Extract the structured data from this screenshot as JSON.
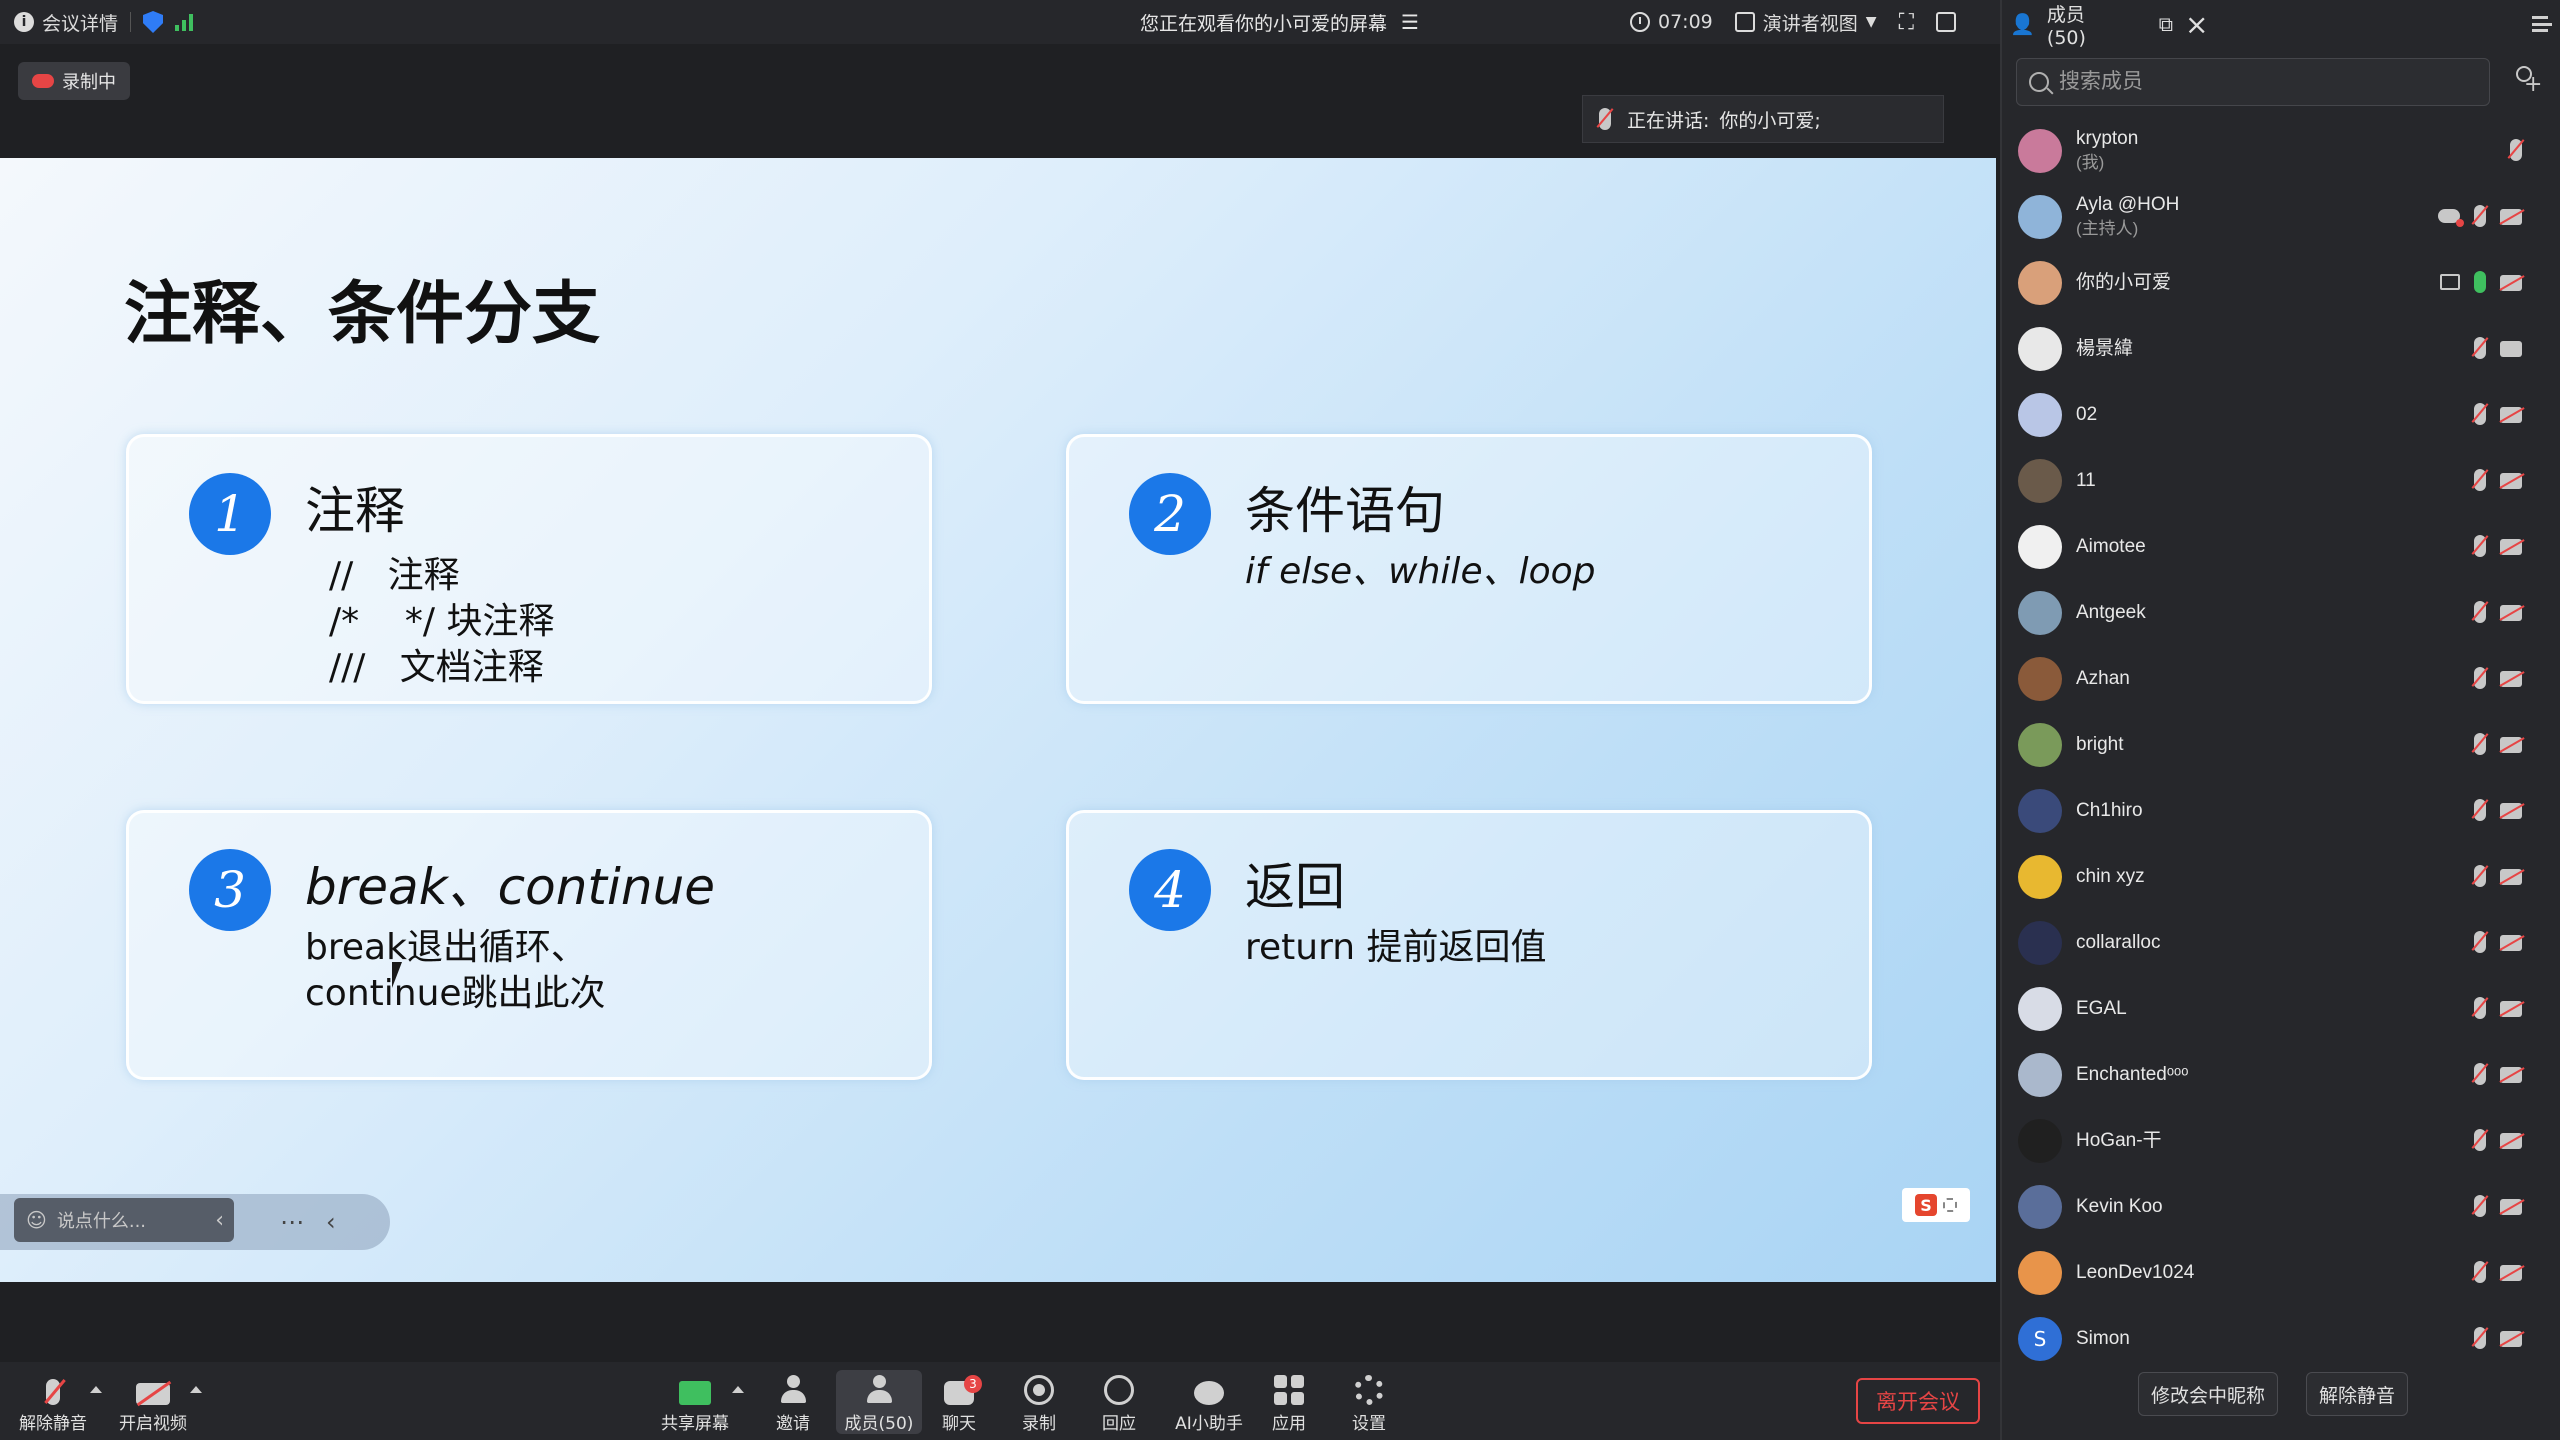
{
  "topbar": {
    "meeting_info": "会议详情",
    "watching": "您正在观看你的小可爱的屏幕",
    "time": "07:09",
    "view_mode": "演讲者视图",
    "members_tab": "成员(50)"
  },
  "recording": {
    "label": "录制中"
  },
  "speaking": {
    "label": "正在讲话:",
    "name": "你的小可爱;"
  },
  "slide": {
    "title": "注释、条件分支",
    "cards": [
      {
        "num": "1",
        "title": "注释",
        "lines": [
          "//   注释",
          "/*    */ 块注释",
          "///   文档注释"
        ]
      },
      {
        "num": "2",
        "title": "条件语句",
        "lines": [
          "if else、while、loop"
        ]
      },
      {
        "num": "3",
        "title": "break、continue",
        "lines": [
          "break退出循环、",
          "continue跳出此次"
        ]
      },
      {
        "num": "4",
        "title": "返回",
        "lines": [
          "return 提前返回值"
        ]
      }
    ],
    "chat_placeholder": "说点什么..."
  },
  "toolbar": {
    "unmute": "解除静音",
    "start_video": "开启视频",
    "share": "共享屏幕",
    "invite": "邀请",
    "members": "成员(50)",
    "chat": "聊天",
    "chat_badge": "3",
    "record": "录制",
    "reply": "回应",
    "ai": "AI小助手",
    "apps": "应用",
    "settings": "设置",
    "leave": "离开会议"
  },
  "panel": {
    "search_placeholder": "搜索成员",
    "members": [
      {
        "name": "krypton",
        "sub": "(我)",
        "color": "#c97a9b",
        "mic": "muted",
        "cam": "none"
      },
      {
        "name": "Ayla @HOH",
        "sub": "(主持人)",
        "color": "#8fb4d9",
        "mic": "muted",
        "cam": "off",
        "extra": "cloud"
      },
      {
        "name": "你的小可爱",
        "sub": "",
        "color": "#d9a07a",
        "mic": "on",
        "cam": "off",
        "extra": "screen"
      },
      {
        "name": "楊景緯",
        "sub": "",
        "color": "#e8e8e8",
        "mic": "muted",
        "cam": "on"
      },
      {
        "name": "02",
        "sub": "",
        "color": "#b9c6e6",
        "mic": "muted",
        "cam": "off"
      },
      {
        "name": "11",
        "sub": "",
        "color": "#6a5a4a",
        "mic": "muted",
        "cam": "off"
      },
      {
        "name": "Aimotee",
        "sub": "",
        "color": "#f0f0f0",
        "mic": "muted",
        "cam": "off"
      },
      {
        "name": "Antgeek",
        "sub": "",
        "color": "#7f9bb3",
        "mic": "muted",
        "cam": "off"
      },
      {
        "name": "Azhan",
        "sub": "",
        "color": "#8a5a3a",
        "mic": "muted",
        "cam": "off"
      },
      {
        "name": "bright",
        "sub": "",
        "color": "#7a9a5a",
        "mic": "muted",
        "cam": "off"
      },
      {
        "name": "Ch1hiro",
        "sub": "",
        "color": "#3a4a7a",
        "mic": "muted",
        "cam": "off"
      },
      {
        "name": "chin xyz",
        "sub": "",
        "color": "#e8b830",
        "mic": "muted",
        "cam": "off"
      },
      {
        "name": "collaralloc",
        "sub": "",
        "color": "#2a3050",
        "mic": "muted",
        "cam": "off"
      },
      {
        "name": "EGAL",
        "sub": "",
        "color": "#d8dce6",
        "mic": "muted",
        "cam": "off"
      },
      {
        "name": "Enchantedᵒᵒᵒ",
        "sub": "",
        "color": "#aab8cc",
        "mic": "muted",
        "cam": "off"
      },
      {
        "name": "HoGan-干",
        "sub": "",
        "color": "#202020",
        "mic": "muted",
        "cam": "off"
      },
      {
        "name": "Kevin Koo",
        "sub": "",
        "color": "#5a6e9a",
        "mic": "muted",
        "cam": "off"
      },
      {
        "name": "LeonDev1024",
        "sub": "",
        "color": "#e8944a",
        "mic": "muted",
        "cam": "off"
      },
      {
        "name": "Simon",
        "sub": "",
        "color": "#2f6fd6",
        "mic": "muted",
        "cam": "off",
        "initial": "S"
      }
    ],
    "rename_button": "修改会中昵称",
    "unmute_all_button": "解除静音"
  }
}
